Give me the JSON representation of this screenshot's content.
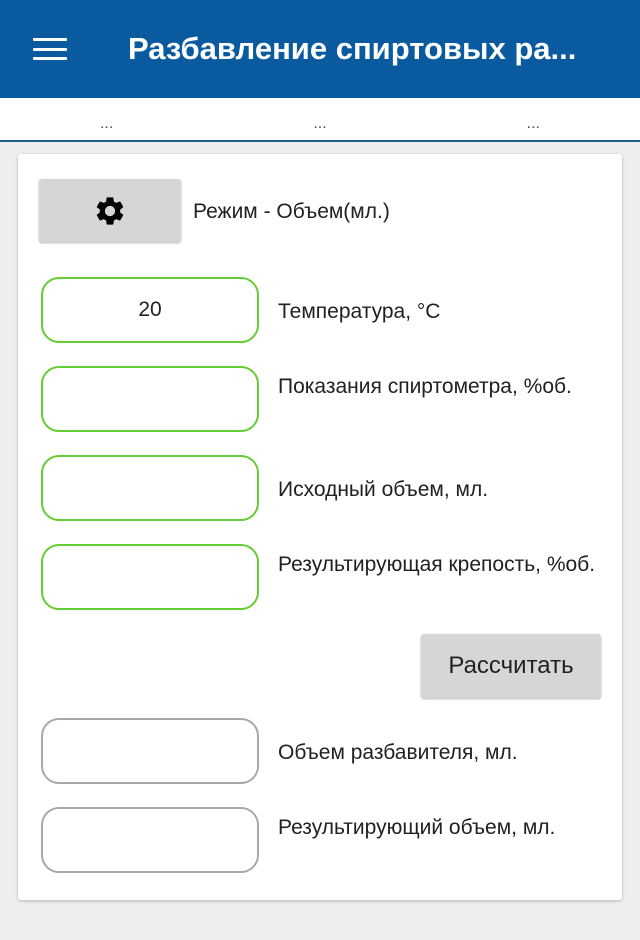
{
  "appbar": {
    "title": "Разбавление спиртовых ра...",
    "menu_icon": "hamburger-menu-icon"
  },
  "tabs": [
    "...",
    "...",
    "..."
  ],
  "mode": {
    "icon": "gear-icon",
    "label": "Режим - Объем(мл.)"
  },
  "inputs": [
    {
      "value": "20",
      "label": "Температура, °C"
    },
    {
      "value": "",
      "label": "Показания спиртометра, %об."
    },
    {
      "value": "",
      "label": "Исходный объем, мл."
    },
    {
      "value": "",
      "label": "Результирующая крепость, %об."
    }
  ],
  "calculate_label": "Рассчитать",
  "outputs": [
    {
      "value": "",
      "label": "Объем разбавителя, мл."
    },
    {
      "value": "",
      "label": "Результирующий объем, мл."
    }
  ],
  "colors": {
    "appbar": "#0a5aa0",
    "input_border_active": "#66cc33",
    "output_border": "#a8a8a8",
    "button_bg": "#d6d6d6"
  }
}
